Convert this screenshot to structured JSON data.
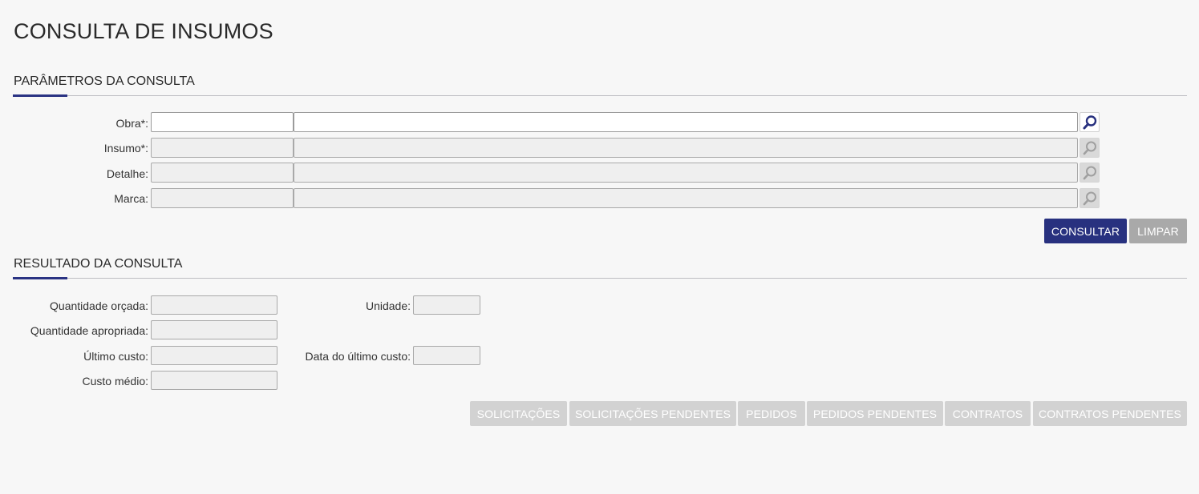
{
  "page": {
    "title": "CONSULTA DE INSUMOS"
  },
  "parameters": {
    "section_title": "PARÂMETROS DA CONSULTA",
    "fields": [
      {
        "label": "Obra*:",
        "code_value": "",
        "description_value": "",
        "enabled": true
      },
      {
        "label": "Insumo*:",
        "code_value": "",
        "description_value": "",
        "enabled": false
      },
      {
        "label": "Detalhe:",
        "code_value": "",
        "description_value": "",
        "enabled": false
      },
      {
        "label": "Marca:",
        "code_value": "",
        "description_value": "",
        "enabled": false
      }
    ],
    "consult_label": "CONSULTAR",
    "clear_label": "LIMPAR"
  },
  "results": {
    "section_title": "RESULTADO DA CONSULTA",
    "quantidade_orcada": {
      "label": "Quantidade orçada:",
      "value": ""
    },
    "unidade": {
      "label": "Unidade:",
      "value": ""
    },
    "quantidade_apropriada": {
      "label": "Quantidade apropriada:",
      "value": ""
    },
    "ultimo_custo": {
      "label": "Último custo:",
      "value": ""
    },
    "data_ultimo_custo": {
      "label": "Data do último custo:",
      "value": ""
    },
    "custo_medio": {
      "label": "Custo médio:",
      "value": ""
    },
    "actions": [
      "SOLICITAÇÕES",
      "SOLICITAÇÕES PENDENTES",
      "PEDIDOS",
      "PEDIDOS PENDENTES",
      "CONTRATOS",
      "CONTRATOS PENDENTES"
    ]
  },
  "colors": {
    "primary": "#28317f",
    "accent_rule": "#2a3383",
    "disabled_button": "#a9a9a9",
    "action_button": "#d2d2d2",
    "background": "#f7f7f7"
  },
  "icons": {
    "lookup": "magnifier-icon"
  }
}
